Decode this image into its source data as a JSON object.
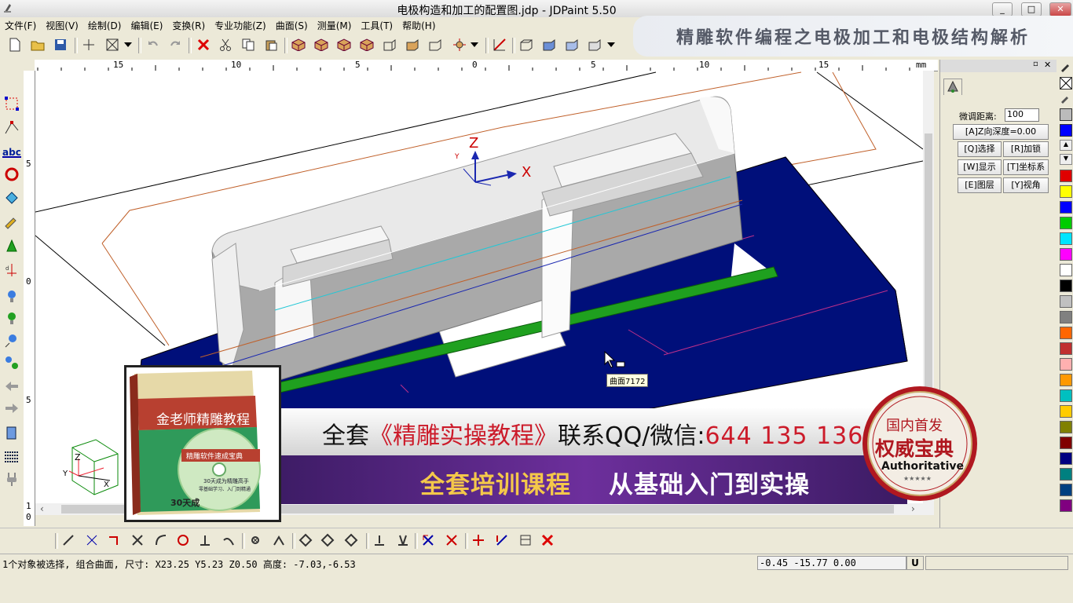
{
  "window": {
    "title": "电极构造和加工的配置图.jdp - JDPaint 5.50",
    "minimize": "_",
    "maximize": "□",
    "close": "✕"
  },
  "menu": [
    {
      "label": "文件(F)"
    },
    {
      "label": "视图(V)"
    },
    {
      "label": "绘制(D)"
    },
    {
      "label": "编辑(E)"
    },
    {
      "label": "变换(R)"
    },
    {
      "label": "专业功能(Z)"
    },
    {
      "label": "曲面(S)"
    },
    {
      "label": "测量(M)"
    },
    {
      "label": "工具(T)"
    },
    {
      "label": "帮助(H)"
    }
  ],
  "banner_top": {
    "text": "精雕软件编程之电极加工和电极结构解析"
  },
  "ruler": {
    "unit": "mm",
    "h_ticks": [
      "15",
      "10",
      "5",
      "0",
      "5",
      "10",
      "15"
    ],
    "v_ticks": [
      "5",
      "0",
      "5",
      "1",
      "0"
    ]
  },
  "canvas": {
    "axis_x": "X",
    "axis_y": "Y",
    "axis_z": "Z",
    "tooltip": "曲面7172",
    "cube_z": "Z",
    "cube_y": "Y",
    "cube_x": "X"
  },
  "panel": {
    "distance_label": "微调距离:",
    "distance_value": "100",
    "z_depth": "[A]Z向深度=0.00",
    "buttons": [
      {
        "label": "[Q]选择"
      },
      {
        "label": "[R]加锁"
      },
      {
        "label": "[W]显示"
      },
      {
        "label": "[T]坐标系"
      },
      {
        "label": "[E]图层"
      },
      {
        "label": "[Y]视角"
      }
    ]
  },
  "palette": [
    "#e00000",
    "#ffff00",
    "#0000ff",
    "#00cc00",
    "#00e5ff",
    "#ff00ff",
    "#ffffff",
    "#000000",
    "#c0c0c0",
    "#808080",
    "#ff6600",
    "#c03030",
    "#ffb0b0",
    "#ff9900",
    "#00c0c0",
    "#ffcc00",
    "#808000",
    "#800000",
    "#000080",
    "#008080",
    "#004080",
    "#800080"
  ],
  "status": {
    "message": "1个对象被选择, 组合曲面, 尺寸: X23.25 Y5.23 Z0.50 高度: -7.03,-6.53",
    "coords": "-0.45 -15.77 0.00",
    "mode": "U"
  },
  "ad": {
    "line1_prefix": "全套",
    "line1_highlight": "《精雕实操教程》",
    "line1_suffix": "联系QQ/微信:",
    "line1_number": "644 135 136",
    "line2_a": "全套培训课程",
    "line2_b": "从基础入门到实操",
    "book_title": "金老师精雕教程",
    "book_sub": "精雕软件速成宝典",
    "disc_text": "30天成为精雕高手",
    "disc_sub": "零基础学习、入门到精通",
    "book_bottom": "30天成",
    "seal_top": "国内首发",
    "seal_main": "权威宝典",
    "seal_en": "Authoritative",
    "seal_stars": "★★★★★"
  },
  "colors": {
    "navy_block": "#000f7a",
    "electrode_gray": "#a9a9a9",
    "green_strip": "#1fa01f",
    "accent_red": "#cc1b2a"
  }
}
